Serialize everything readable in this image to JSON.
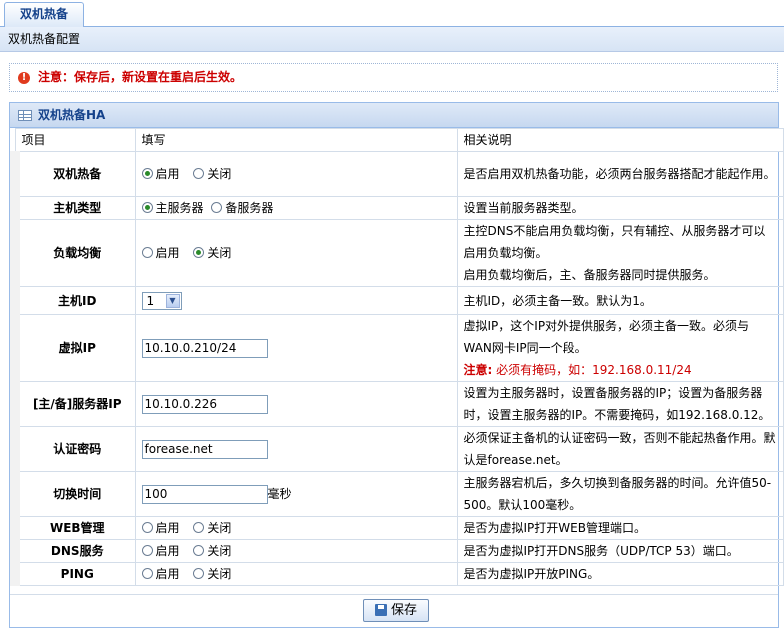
{
  "tab": {
    "label": "双机热备"
  },
  "subheader": {
    "title": "双机热备配置"
  },
  "notice": {
    "text": "注意：保存后，新设置在重启后生效。"
  },
  "panel": {
    "title": "双机热备HA"
  },
  "columns": {
    "item": "项目",
    "fill": "填写",
    "desc": "相关说明"
  },
  "rows": {
    "ha": {
      "label": "双机热备",
      "opt1": "启用",
      "opt2": "关闭",
      "selected": "opt1",
      "desc": "是否启用双机热备功能，必须两台服务器搭配才能起作用。"
    },
    "host_type": {
      "label": "主机类型",
      "opt1": "主服务器",
      "opt2": "备服务器",
      "selected": "opt1",
      "desc": "设置当前服务器类型。"
    },
    "load_balance": {
      "label": "负载均衡",
      "opt1": "启用",
      "opt2": "关闭",
      "selected": "opt2",
      "desc1": "主控DNS不能启用负载均衡，只有辅控、从服务器才可以启用负载均衡。",
      "desc2": "启用负载均衡后，主、备服务器同时提供服务。"
    },
    "host_id": {
      "label": "主机ID",
      "value": "1",
      "desc": "主机ID，必须主备一致。默认为1。"
    },
    "vip": {
      "label": "虚拟IP",
      "value": "10.10.0.210/24",
      "desc": "虚拟IP，这个IP对外提供服务，必须主备一致。必须与WAN网卡IP同一个段。",
      "note_label": "注意:",
      "note": " 必须有掩码，如：192.168.0.11/24"
    },
    "server_ip": {
      "label": "[主/备]服务器IP",
      "value": "10.10.0.226",
      "desc": "设置为主服务器时，设置备服务器的IP；设置为备服务器时，设置主服务器的IP。不需要掩码，如192.168.0.12。"
    },
    "auth": {
      "label": "认证密码",
      "value": "forease.net",
      "desc": "必须保证主备机的认证密码一致，否则不能起热备作用。默认是forease.net。"
    },
    "switch_time": {
      "label": "切换时间",
      "value": "100",
      "unit": "毫秒",
      "desc": "主服务器宕机后，多久切换到备服务器的时间。允许值50-500。默认100毫秒。"
    },
    "web": {
      "label": "WEB管理",
      "opt1": "启用",
      "opt2": "关闭",
      "selected": "opt1",
      "desc": "是否为虚拟IP打开WEB管理端口。"
    },
    "dns": {
      "label": "DNS服务",
      "opt1": "启用",
      "opt2": "关闭",
      "selected": "opt1",
      "desc": "是否为虚拟IP打开DNS服务（UDP/TCP 53）端口。"
    },
    "ping": {
      "label": "PING",
      "opt1": "启用",
      "opt2": "关闭",
      "selected": "opt1",
      "desc": "是否为虚拟IP开放PING。"
    }
  },
  "save_label": "保存"
}
